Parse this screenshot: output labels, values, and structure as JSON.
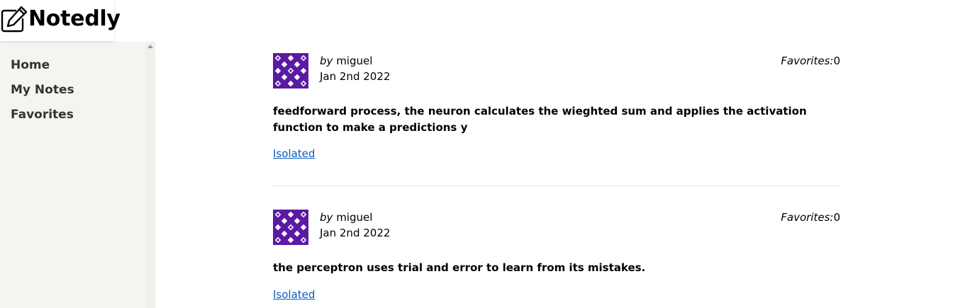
{
  "app": {
    "logo_text": "Notedly"
  },
  "sidebar": {
    "items": [
      {
        "label": "Home"
      },
      {
        "label": "My Notes"
      },
      {
        "label": "Favorites"
      }
    ]
  },
  "notes": [
    {
      "by_prefix": "by",
      "author": "miguel",
      "date": "Jan 2nd 2022",
      "favorites_label": "Favorites:",
      "favorites_count": "0",
      "content": "feedforward process, the neuron calculates the wieghted sum and applies the activation function to make a predictions y",
      "link_text": "Isolated"
    },
    {
      "by_prefix": "by",
      "author": "miguel",
      "date": "Jan 2nd 2022",
      "favorites_label": "Favorites:",
      "favorites_count": "0",
      "content": "the perceptron uses trial and error to learn from its mistakes.",
      "link_text": "Isolated"
    }
  ],
  "colors": {
    "sidebar_bg": "#f5f4f0",
    "link": "#0a5bbf",
    "avatar_purple": "#5b1aa3"
  },
  "icons": {
    "logo": "pencil-square-icon",
    "avatar": "identicon-avatar"
  }
}
